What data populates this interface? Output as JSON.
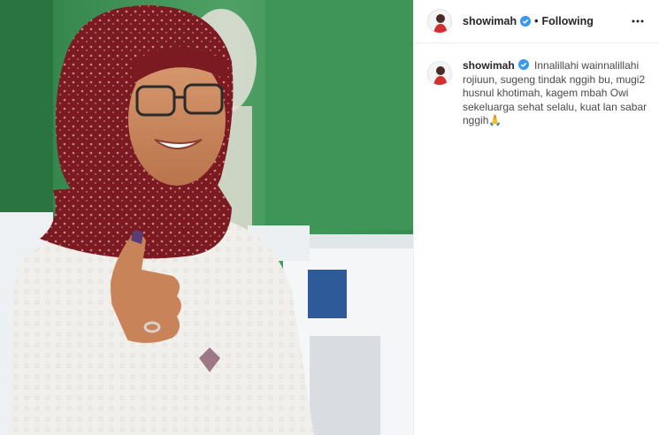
{
  "post": {
    "username": "showimah",
    "follow_state": "Following",
    "separator": "•"
  },
  "caption": {
    "username": "showimah",
    "text": "Innalillahi wainnalillahi rojiuun, sugeng tindak nggih bu, mugi2 husnul khotimah, kagem mbah Owi sekeluarga sehat selalu, kuat lan sabar nggih🙏"
  },
  "icons": {
    "verified": "verified-badge-icon",
    "more": "more-options-icon"
  },
  "colors": {
    "verified_blue": "#3897f0",
    "text": "#262626",
    "border": "#efefef"
  }
}
